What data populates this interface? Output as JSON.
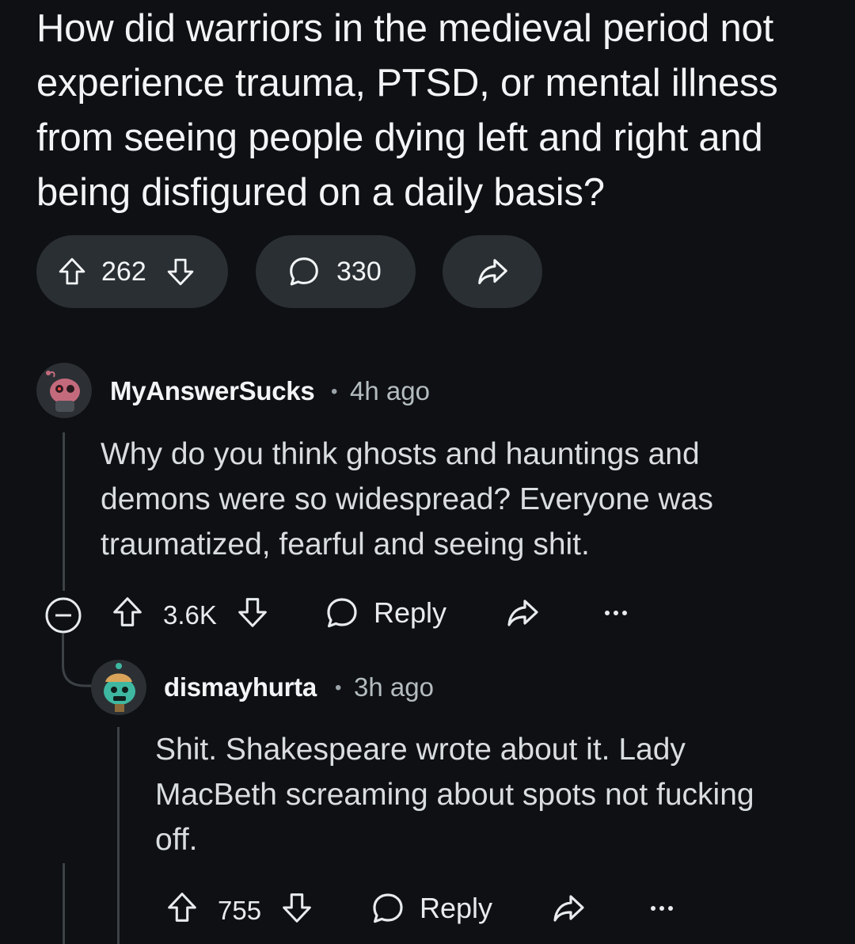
{
  "post": {
    "title": "How did warriors in the medieval period not experience trauma, PTSD, or mental illness from seeing people dying left and right and being disfigured on a daily basis?",
    "upvotes": "262",
    "comments": "330",
    "icons": {
      "upvote": "arrow-up-icon",
      "downvote": "arrow-down-icon",
      "comment": "speech-bubble-icon",
      "share": "share-arrow-icon"
    }
  },
  "comments": [
    {
      "username": "MyAnswerSucks",
      "separator": "•",
      "time": "4h ago",
      "body": "Why do you think ghosts and hauntings and demons were so widespread? Everyone was traumatized, fearful and seeing shit.",
      "score": "3.6K",
      "reply_label": "Reply"
    },
    {
      "username": "dismayhurta",
      "separator": "•",
      "time": "3h ago",
      "body": "Shit. Shakespeare wrote about it. Lady MacBeth screaming about spots not fucking off.",
      "score": "755",
      "reply_label": "Reply"
    }
  ],
  "colors": {
    "background": "#0e1013",
    "pill": "#2a2f33",
    "text": "#f2f4f5",
    "muted": "#b4bcc0",
    "thread": "#3c4246"
  }
}
